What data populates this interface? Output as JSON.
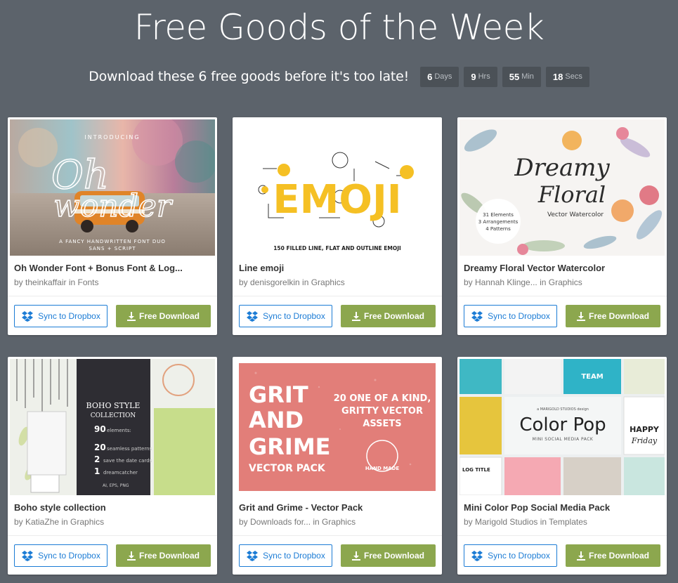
{
  "header": {
    "title": "Free Goods of the Week",
    "subtitle": "Download these 6 free goods before it's too late!"
  },
  "timer": [
    {
      "value": "6",
      "unit": "Days"
    },
    {
      "value": "9",
      "unit": "Hrs"
    },
    {
      "value": "55",
      "unit": "Min"
    },
    {
      "value": "18",
      "unit": "Secs"
    }
  ],
  "buttons": {
    "sync_label": "Sync to Dropbox",
    "download_label": "Free Download"
  },
  "cards": [
    {
      "title": "Oh Wonder Font + Bonus Font & Log...",
      "byline": "by theinkaffair in Fonts",
      "thumb": {
        "intro": "INTRODUCING",
        "script1": "Oh",
        "script2": "wonder",
        "tagline": "A FANCY HANDWRITTEN FONT DUO",
        "tagline2": "SANS + SCRIPT"
      }
    },
    {
      "title": "Line emoji",
      "byline": "by denisgorelkin in Graphics",
      "thumb": {
        "word": "EMOJI",
        "caption": "150 FILLED LINE, FLAT AND OUTLINE EMOJI"
      }
    },
    {
      "title": "Dreamy Floral Vector Watercolor",
      "byline": "by Hannah Klinge... in Graphics",
      "thumb": {
        "script1": "Dreamy",
        "script2": "Floral",
        "sub": "Vector Watercolor",
        "badge1": "31 Elements",
        "badge2": "3 Arrangements",
        "badge3": "4 Patterns"
      }
    },
    {
      "title": "Boho style collection",
      "byline": "by KatiaZhe in Graphics",
      "thumb": {
        "h1": "BOHO STYLE",
        "h2": "COLLECTION",
        "n1": "90",
        "t1": "elements:",
        "n2": "20",
        "t2": "seamless patterns",
        "n3": "2",
        "t3": "save the date cards",
        "n4": "1",
        "t4": "dreamcatcher",
        "fmt": "AI, EPS, PNG"
      }
    },
    {
      "title": "Grit and Grime - Vector Pack",
      "byline": "by Downloads for... in Graphics",
      "thumb": {
        "l1": "GRIT",
        "l2": "AND",
        "l3": "GRIME",
        "l4": "VECTOR PACK",
        "r1": "20 ONE OF A KIND,",
        "r2": "GRITTY VECTOR",
        "r3": "ASSETS",
        "stamp": "HAND MADE"
      }
    },
    {
      "title": "Mini Color Pop Social Media Pack",
      "byline": "by Marigold Studios in Templates",
      "thumb": {
        "small": "a MARIGOLD STUDIOS design",
        "big": "Color Pop",
        "sub": "MINI SOCIAL MEDIA PACK",
        "team": "TEAM",
        "happy": "HAPPY",
        "friday": "Friday",
        "log": "LOG TITLE"
      }
    }
  ]
}
